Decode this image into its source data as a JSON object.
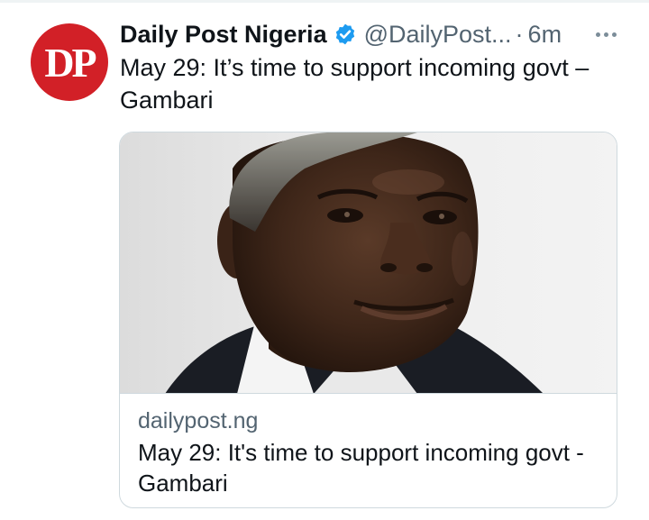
{
  "tweet": {
    "avatar_text": "DP",
    "display_name": "Daily Post Nigeria",
    "handle": "@DailyPost...",
    "separator": "·",
    "time": "6m",
    "text": "May 29: It’s time to support incoming govt – Gambari",
    "icons": {
      "verified": "verified-badge-icon",
      "more": "more-options-icon"
    }
  },
  "card": {
    "image": "portrait-photo",
    "domain": "dailypost.ng",
    "title": "May 29: It's time to support incoming govt - Gambari"
  },
  "colors": {
    "avatar_bg": "#d22027",
    "verified_blue": "#1d9bf0",
    "secondary_text": "#536471",
    "border": "#cfd9de"
  }
}
